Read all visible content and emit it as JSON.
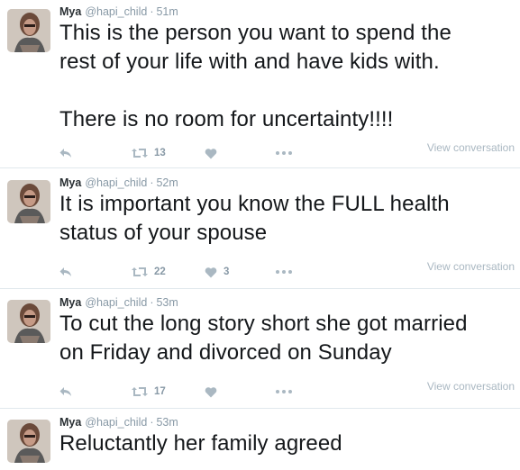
{
  "tweets": [
    {
      "name": "Mya",
      "handle": "@hapi_child",
      "sep": "·",
      "time": "51m",
      "text": "This is the person you want to spend the\nrest of your life with and have kids with.\n\nThere is no room for uncertainty!!!!",
      "retweets": "13",
      "likes": "",
      "view_conversation": "View conversation"
    },
    {
      "name": "Mya",
      "handle": "@hapi_child",
      "sep": "·",
      "time": "52m",
      "text": "It is important you know the FULL health\nstatus of your spouse",
      "retweets": "22",
      "likes": "3",
      "view_conversation": "View conversation"
    },
    {
      "name": "Mya",
      "handle": "@hapi_child",
      "sep": "·",
      "time": "53m",
      "text": "To cut the long story short she got married\non Friday and divorced on Sunday",
      "retweets": "17",
      "likes": "",
      "view_conversation": "View conversation"
    },
    {
      "name": "Mya",
      "handle": "@hapi_child",
      "sep": "·",
      "time": "53m",
      "text": "Reluctantly her family agreed",
      "retweets": "",
      "likes": "",
      "view_conversation": ""
    }
  ],
  "colors": {
    "icon": "#aab8c2",
    "meta": "#8899a6",
    "divider": "#e1e8ed"
  },
  "icons": [
    "avatar",
    "reply-icon",
    "retweet-icon",
    "heart-icon",
    "more-icon"
  ]
}
